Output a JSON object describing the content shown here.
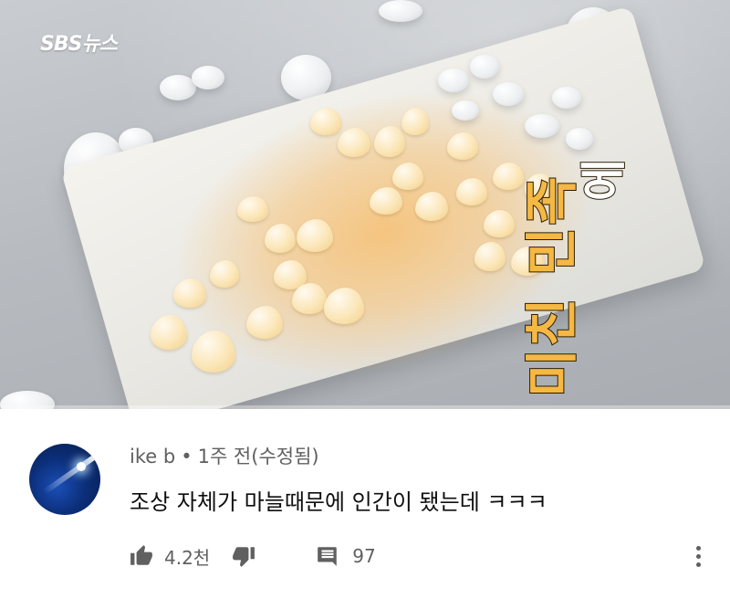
{
  "video": {
    "channel_logo": "SBS뉴스",
    "caption_top": "에",
    "caption_main": "미친 민족",
    "progress_fraction": 0.0
  },
  "comment": {
    "author": "ike b",
    "separator": "•",
    "time": "1주 전(수정됨)",
    "text": "조상 자체가 마늘때문에 인간이 됐는데 ㅋㅋㅋ",
    "like_count": "4.2천",
    "reply_count": "97"
  },
  "icons": {
    "like": "thumbs-up-icon",
    "dislike": "thumbs-down-icon",
    "reply": "comment-icon",
    "more": "more-vert-icon"
  },
  "colors": {
    "caption_fill": "#f5b843",
    "caption_stroke": "#2a1c05",
    "meta_text": "#606060",
    "body_text": "#0f0f0f",
    "progress": "#ff0000"
  }
}
